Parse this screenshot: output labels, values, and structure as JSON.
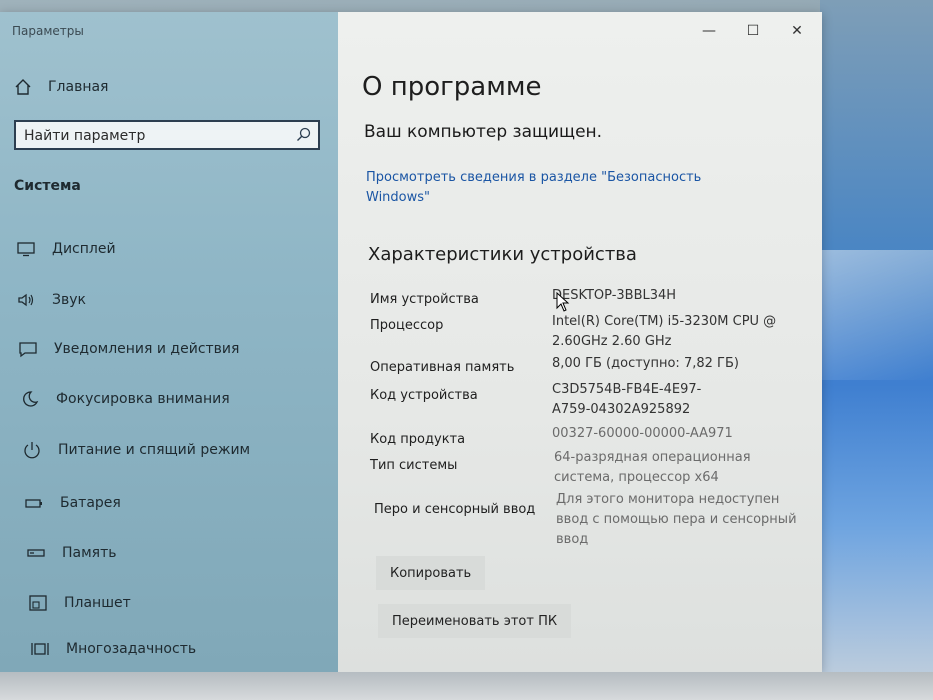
{
  "window": {
    "title": "Параметры",
    "controls": [
      "—",
      "☐",
      "✕"
    ]
  },
  "sidebar": {
    "home_label": "Главная",
    "search_placeholder": "Найти параметр",
    "section_title": "Система",
    "items": [
      {
        "label": "Дисплей",
        "icon": "display-icon"
      },
      {
        "label": "Звук",
        "icon": "speaker-icon"
      },
      {
        "label": "Уведомления и действия",
        "icon": "notification-icon"
      },
      {
        "label": "Фокусировка внимания",
        "icon": "moon-icon"
      },
      {
        "label": "Питание и спящий режим",
        "icon": "power-icon"
      },
      {
        "label": "Батарея",
        "icon": "battery-icon"
      },
      {
        "label": "Память",
        "icon": "storage-icon"
      },
      {
        "label": "Планшет",
        "icon": "tablet-icon"
      },
      {
        "label": "Многозадачность",
        "icon": "multitasking-icon"
      }
    ]
  },
  "main": {
    "page_title": "О программе",
    "protected_text": "Ваш компьютер защищен.",
    "security_link": "Просмотреть сведения в разделе \"Безопасность Windows\"",
    "specs_title": "Характеристики устройства",
    "specs": [
      {
        "label": "Имя устройства",
        "value": "DESKTOP-3BBL34H"
      },
      {
        "label": "Процессор",
        "value": "Intel(R) Core(TM) i5-3230M CPU @ 2.60GHz   2.60 GHz"
      },
      {
        "label": "Оперативная память",
        "value": "8,00 ГБ (доступно: 7,82 ГБ)"
      },
      {
        "label": "Код устройства",
        "value": "C3D5754B-FB4E-4E97-A759-04302A925892"
      },
      {
        "label": "Код продукта",
        "value": "00327-60000-00000-AA971"
      },
      {
        "label": "Тип системы",
        "value": "64-разрядная операционная система, процессор x64"
      },
      {
        "label": "Перо и сенсорный ввод",
        "value": "Для этого монитора недоступен ввод с помощью пера и сенсорный ввод"
      }
    ],
    "copy_button": "Копировать",
    "rename_button": "Переименовать этот ПК"
  },
  "colors": {
    "link": "#1a55a4",
    "sidebar_bg": "#9fc1ce",
    "main_bg": "#eef0ee"
  }
}
